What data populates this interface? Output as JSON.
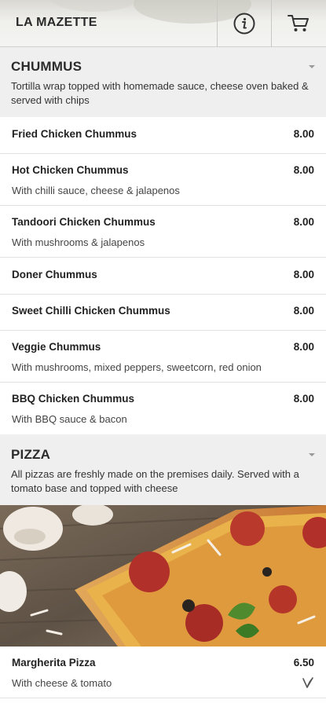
{
  "header": {
    "brand": "LA MAZETTE",
    "info_icon": "info-icon",
    "cart_icon": "cart-icon"
  },
  "sections": [
    {
      "title": "CHUMMUS",
      "description": "Tortilla wrap topped with homemade sauce, cheese oven baked & served with chips",
      "items": [
        {
          "name": "Fried Chicken Chummus",
          "price": "8.00",
          "desc": ""
        },
        {
          "name": "Hot Chicken Chummus",
          "price": "8.00",
          "desc": "With chilli sauce, cheese & jalapenos"
        },
        {
          "name": "Tandoori Chicken Chummus",
          "price": "8.00",
          "desc": "With mushrooms & jalapenos"
        },
        {
          "name": "Doner Chummus",
          "price": "8.00",
          "desc": ""
        },
        {
          "name": "Sweet Chilli Chicken Chummus",
          "price": "8.00",
          "desc": ""
        },
        {
          "name": "Veggie Chummus",
          "price": "8.00",
          "desc": "With mushrooms, mixed peppers, sweetcorn, red onion"
        },
        {
          "name": "BBQ Chicken Chummus",
          "price": "8.00",
          "desc": "With BBQ sauce & bacon"
        }
      ]
    },
    {
      "title": "PIZZA",
      "description": "All pizzas are freshly made on the premises daily. Served with a tomato base and topped with cheese",
      "items": [
        {
          "name": "Margherita Pizza",
          "price": "6.50",
          "desc": "With cheese & tomato",
          "badge_icon": "vegetarian-icon"
        }
      ]
    }
  ]
}
